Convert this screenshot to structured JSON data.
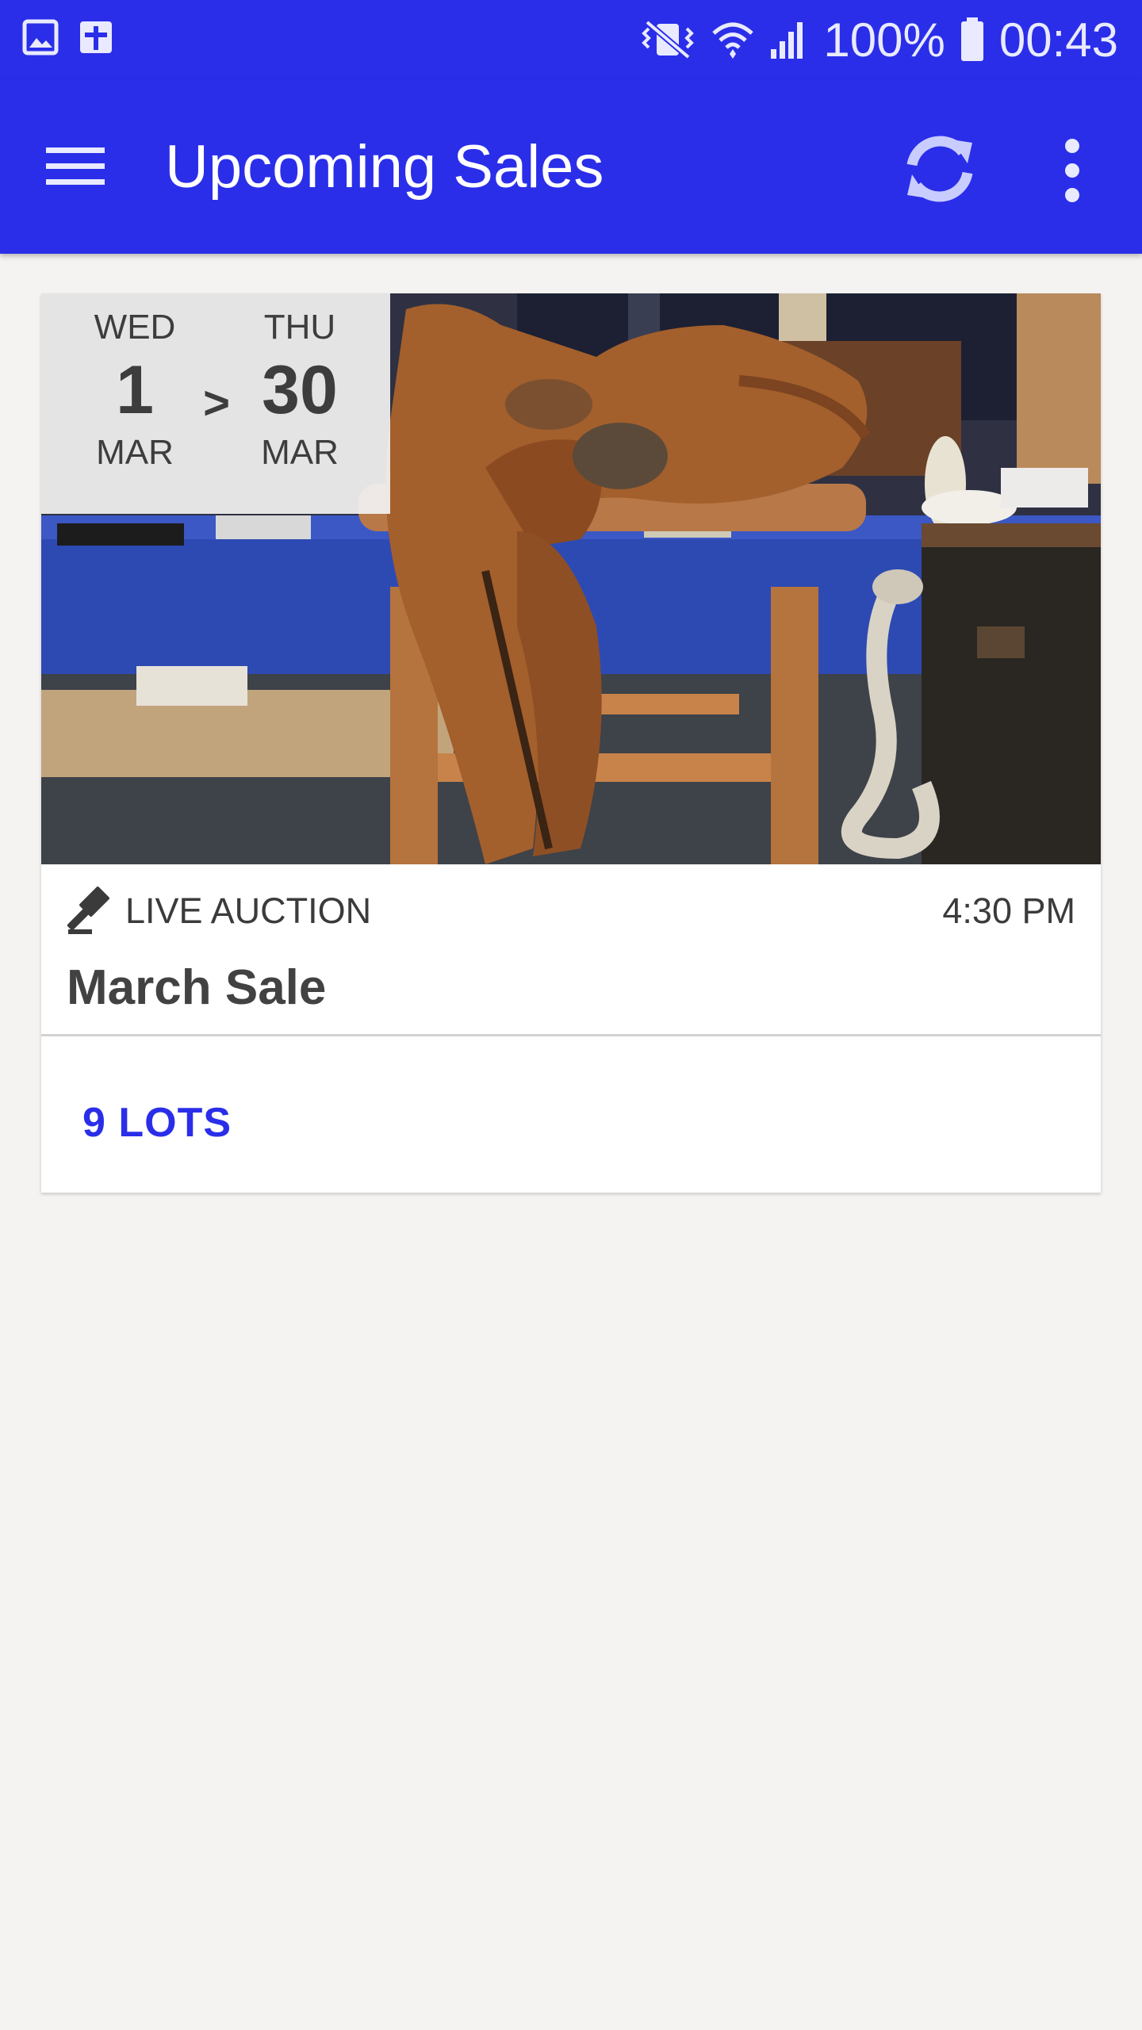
{
  "status_bar": {
    "left_icons": [
      "image-icon",
      "calendar-plus-icon"
    ],
    "right_icons": [
      "vibrate-mute-icon",
      "wifi-icon",
      "signal-icon",
      "battery-icon"
    ],
    "battery": "100%",
    "time": "00:43"
  },
  "app_bar": {
    "title": "Upcoming Sales",
    "icons": [
      "menu-icon",
      "refresh-icon",
      "more-vert-icon"
    ]
  },
  "sale": {
    "date_start": {
      "dow": "WED",
      "day": "1",
      "month": "MAR"
    },
    "date_separator": ">",
    "date_end": {
      "dow": "THU",
      "day": "30",
      "month": "MAR"
    },
    "type_icon": "gavel-icon",
    "type": "LIVE AUCTION",
    "time": "4:30 PM",
    "name": "March Sale",
    "lots_label": "9 LOTS",
    "image": "photo of a leather western saddle on a wooden stand in an auction room"
  },
  "colors": {
    "primary": "#2a2ee9",
    "background": "#f4f3f1",
    "card": "#ffffff",
    "text": "#3d3d3d"
  }
}
